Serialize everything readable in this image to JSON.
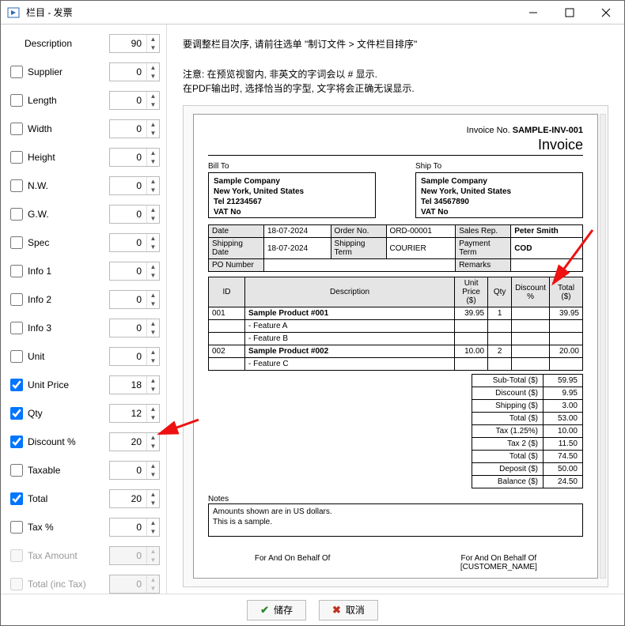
{
  "window": {
    "title": "栏目 - 发票"
  },
  "instructions": {
    "line1": "要调整栏目次序, 请前往选单 \"制订文件 > 文件栏目排序\"",
    "line2a": "注意: 在预览视窗内, 非英文的字词会以 # 显示.",
    "line2b": "在PDF输出时, 选择恰当的字型, 文字将会正确无误显示."
  },
  "columns": [
    {
      "label": "Description",
      "value": "90",
      "checked": null,
      "enabled": true
    },
    {
      "label": "Supplier",
      "value": "0",
      "checked": false,
      "enabled": true
    },
    {
      "label": "Length",
      "value": "0",
      "checked": false,
      "enabled": true
    },
    {
      "label": "Width",
      "value": "0",
      "checked": false,
      "enabled": true
    },
    {
      "label": "Height",
      "value": "0",
      "checked": false,
      "enabled": true
    },
    {
      "label": "N.W.",
      "value": "0",
      "checked": false,
      "enabled": true
    },
    {
      "label": "G.W.",
      "value": "0",
      "checked": false,
      "enabled": true
    },
    {
      "label": "Spec",
      "value": "0",
      "checked": false,
      "enabled": true
    },
    {
      "label": "Info 1",
      "value": "0",
      "checked": false,
      "enabled": true
    },
    {
      "label": "Info 2",
      "value": "0",
      "checked": false,
      "enabled": true
    },
    {
      "label": "Info 3",
      "value": "0",
      "checked": false,
      "enabled": true
    },
    {
      "label": "Unit",
      "value": "0",
      "checked": false,
      "enabled": true
    },
    {
      "label": "Unit Price",
      "value": "18",
      "checked": true,
      "enabled": true
    },
    {
      "label": "Qty",
      "value": "12",
      "checked": true,
      "enabled": true
    },
    {
      "label": "Discount %",
      "value": "20",
      "checked": true,
      "enabled": true
    },
    {
      "label": "Taxable",
      "value": "0",
      "checked": false,
      "enabled": true
    },
    {
      "label": "Total",
      "value": "20",
      "checked": true,
      "enabled": true
    },
    {
      "label": "Tax %",
      "value": "0",
      "checked": false,
      "enabled": true
    },
    {
      "label": "Tax Amount",
      "value": "0",
      "checked": false,
      "enabled": false
    },
    {
      "label": "Total (inc Tax)",
      "value": "0",
      "checked": false,
      "enabled": false
    }
  ],
  "invoice": {
    "number_label": "Invoice No.",
    "number": "SAMPLE-INV-001",
    "title": "Invoice",
    "bill_to_label": "Bill To",
    "ship_to_label": "Ship To",
    "bill_to": {
      "l1": "Sample Company",
      "l2": "New York, United States",
      "l3": "Tel 21234567",
      "l4": "VAT No"
    },
    "ship_to": {
      "l1": "Sample Company",
      "l2": "New York, United States",
      "l3": "Tel 34567890",
      "l4": "VAT No"
    },
    "meta": {
      "date_label": "Date",
      "date": "18-07-2024",
      "order_no_label": "Order No.",
      "order_no": "ORD-00001",
      "sales_rep_label": "Sales Rep.",
      "sales_rep": "Peter Smith",
      "ship_date_label": "Shipping Date",
      "ship_date": "18-07-2024",
      "ship_term_label": "Shipping Term",
      "ship_term": "COURIER",
      "pay_term_label": "Payment Term",
      "pay_term": "COD",
      "po_label": "PO Number",
      "po": "",
      "remarks_label": "Remarks",
      "remarks": ""
    },
    "table_head": {
      "id": "ID",
      "desc": "Description",
      "unit_price": "Unit Price ($)",
      "qty": "Qty",
      "discount": "Discount %",
      "total": "Total ($)"
    },
    "rows": [
      {
        "id": "001",
        "desc": "Sample Product #001",
        "price": "39.95",
        "qty": "1",
        "disc": "",
        "total": "39.95"
      },
      {
        "id": "",
        "desc": "- Feature A",
        "price": "",
        "qty": "",
        "disc": "",
        "total": ""
      },
      {
        "id": "",
        "desc": "- Feature B",
        "price": "",
        "qty": "",
        "disc": "",
        "total": ""
      },
      {
        "id": "002",
        "desc": "Sample Product #002",
        "price": "10.00",
        "qty": "2",
        "disc": "",
        "total": "20.00"
      },
      {
        "id": "",
        "desc": "- Feature C",
        "price": "",
        "qty": "",
        "disc": "",
        "total": ""
      }
    ],
    "totals": [
      {
        "label": "Sub-Total ($)",
        "value": "59.95"
      },
      {
        "label": "Discount ($)",
        "value": "9.95"
      },
      {
        "label": "Shipping ($)",
        "value": "3.00"
      },
      {
        "label": "Total ($)",
        "value": "53.00"
      },
      {
        "label": "Tax (1.25%)",
        "value": "10.00"
      },
      {
        "label": "Tax 2 ($)",
        "value": "11.50"
      },
      {
        "label": "Total ($)",
        "value": "74.50"
      },
      {
        "label": "Deposit ($)",
        "value": "50.00"
      },
      {
        "label": "Balance ($)",
        "value": "24.50"
      }
    ],
    "notes_label": "Notes",
    "notes": {
      "l1": "Amounts shown are in US dollars.",
      "l2": "This is a sample."
    },
    "sign_left": "For And On Behalf Of",
    "sign_right_l1": "For And On Behalf Of",
    "sign_right_l2": "[CUSTOMER_NAME]"
  },
  "buttons": {
    "save": "储存",
    "cancel": "取消"
  }
}
